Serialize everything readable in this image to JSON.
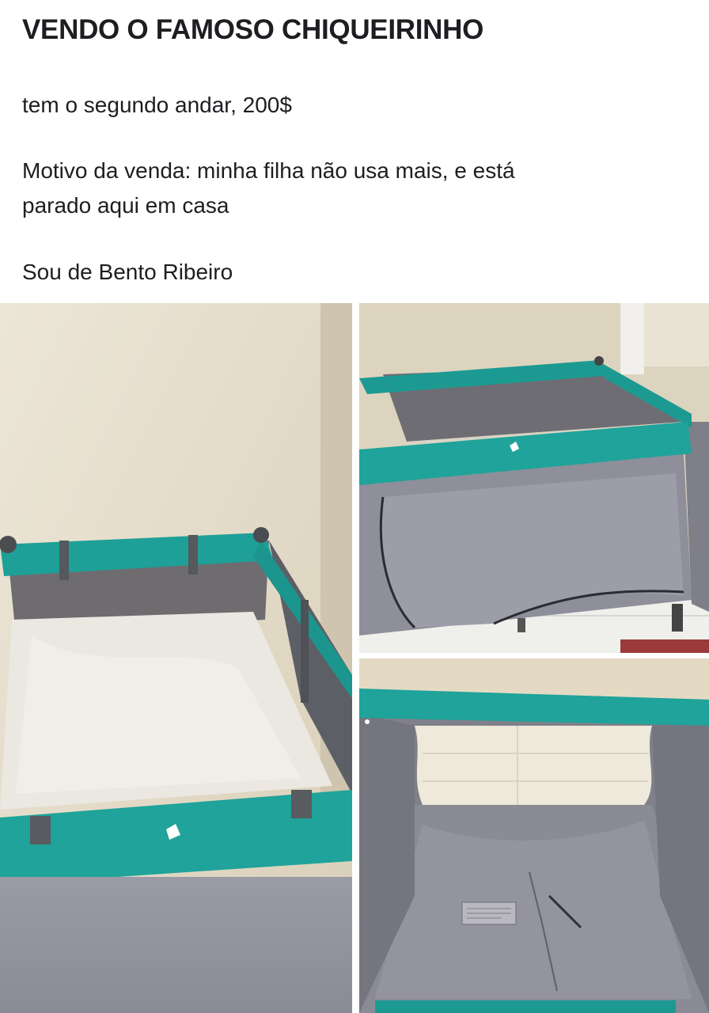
{
  "post": {
    "title": "VENDO O FAMOSO CHIQUEIRINHO",
    "line1": "tem o segundo andar, 200$",
    "line2a": "Motivo da venda: minha filha não usa mais, e está",
    "line2b": "parado aqui em casa",
    "line3": "Sou de Bento Ribeiro"
  },
  "colors": {
    "teal": "#1fa39a",
    "mesh_gray": "#8c8d96",
    "wall_beige": "#e6ddc8",
    "white_mattress": "#ece8e2"
  }
}
